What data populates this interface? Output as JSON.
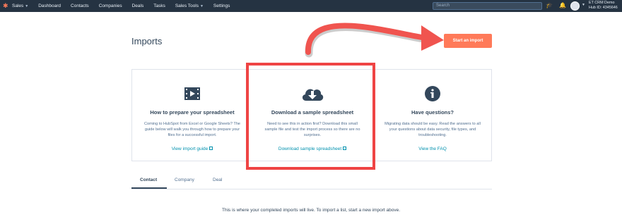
{
  "topnav": {
    "items": [
      "Sales",
      "Dashboard",
      "Contacts",
      "Companies",
      "Deals",
      "Tasks",
      "Sales Tools",
      "Settings"
    ],
    "search_placeholder": "Search",
    "account_name": "ET CRM Demo",
    "hub_id": "Hub ID: 4345646"
  },
  "page": {
    "title": "Imports",
    "start_button": "Start an import"
  },
  "cards": [
    {
      "icon": "video-icon",
      "title": "How to prepare your spreadsheet",
      "description": "Coming to HubSpot from Excel or Google Sheets? The guide below will walk you through how to prepare your files for a successful import.",
      "link": "View import guide"
    },
    {
      "icon": "cloud-download-icon",
      "title": "Download a sample spreadsheet",
      "description": "Need to see this in action first? Download this small sample file and test the import process so there are no surprises.",
      "link": "Download sample spreadsheet"
    },
    {
      "icon": "info-icon",
      "title": "Have questions?",
      "description": "Migrating data should be easy. Read the answers to all your questions about data security, file types, and troubleshooting.",
      "link": "View the FAQ"
    }
  ],
  "tabs": [
    "Contact",
    "Company",
    "Deal"
  ],
  "empty_message": "This is where your completed imports will live. To import a list, start a new import above.",
  "colors": {
    "nav": "#253342",
    "accent": "#ff7a59",
    "link": "#0091ae",
    "annotation": "#ef4444"
  }
}
